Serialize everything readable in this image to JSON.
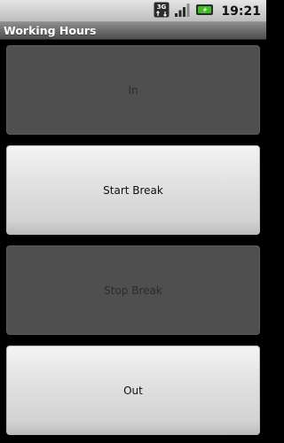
{
  "status_bar": {
    "network_type": "3G",
    "time": "19:21"
  },
  "app": {
    "title": "Working Hours"
  },
  "buttons": [
    {
      "label": "In",
      "enabled": false
    },
    {
      "label": "Start Break",
      "enabled": true
    },
    {
      "label": "Stop Break",
      "enabled": false
    },
    {
      "label": "Out",
      "enabled": true
    }
  ],
  "colors": {
    "background": "#000000",
    "button_disabled": "#4e4f4e",
    "button_enabled": "#e2e2e2",
    "battery_green": "#3fbf1f"
  },
  "icons": [
    "network-3g-icon",
    "signal-strength-icon",
    "battery-charging-icon"
  ]
}
